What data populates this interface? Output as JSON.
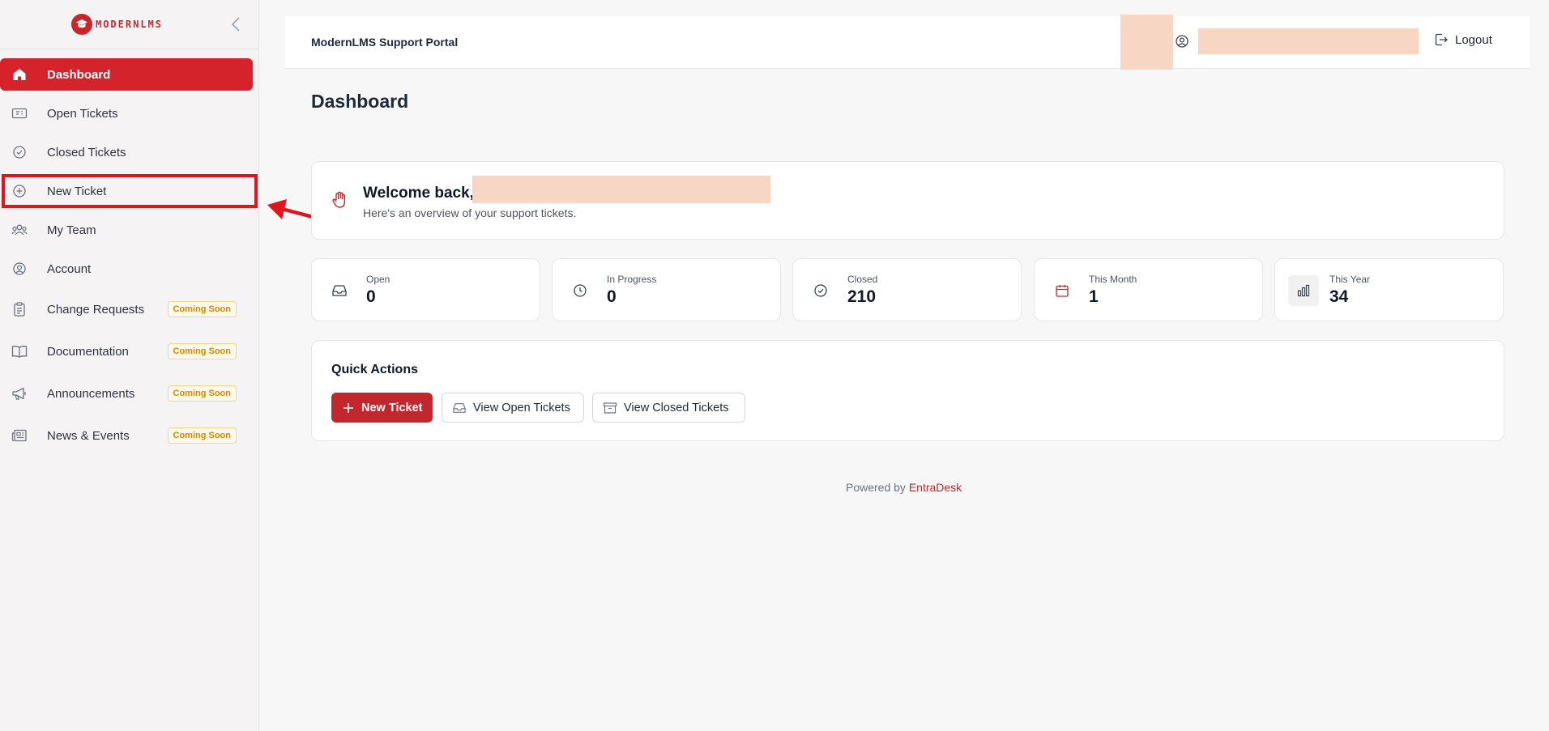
{
  "sidebar": {
    "logo_text": "MODERNLMS",
    "items": [
      {
        "label": "Dashboard",
        "icon": "home-icon"
      },
      {
        "label": "Open Tickets",
        "icon": "ticket-icon"
      },
      {
        "label": "Closed Tickets",
        "icon": "check-circle-icon"
      },
      {
        "label": "New Ticket",
        "icon": "plus-circle-icon"
      },
      {
        "label": "My Team",
        "icon": "users-icon"
      },
      {
        "label": "Account",
        "icon": "user-circle-icon"
      },
      {
        "label": "Change Requests",
        "icon": "clipboard-icon",
        "badge": "Coming Soon"
      },
      {
        "label": "Documentation",
        "icon": "book-icon",
        "badge": "Coming Soon"
      },
      {
        "label": "Announcements",
        "icon": "megaphone-icon",
        "badge": "Coming Soon"
      },
      {
        "label": "News & Events",
        "icon": "newspaper-icon",
        "badge": "Coming Soon"
      }
    ]
  },
  "header": {
    "title": "ModernLMS Support Portal",
    "logout_label": "Logout"
  },
  "main": {
    "page_title": "Dashboard",
    "welcome": {
      "title": "Welcome back,",
      "subtitle": "Here's an overview of your support tickets."
    },
    "stats": [
      {
        "label": "Open",
        "value": "0",
        "icon": "inbox-icon"
      },
      {
        "label": "In Progress",
        "value": "0",
        "icon": "clock-icon"
      },
      {
        "label": "Closed",
        "value": "210",
        "icon": "check-circle-icon"
      },
      {
        "label": "This Month",
        "value": "1",
        "icon": "calendar-icon"
      },
      {
        "label": "This Year",
        "value": "34",
        "icon": "bar-chart-icon"
      }
    ],
    "quick_actions": {
      "title": "Quick Actions",
      "new_ticket": "New Ticket",
      "view_open": "View Open Tickets",
      "view_closed": "View Closed Tickets"
    },
    "footer": {
      "prefix": "Powered by",
      "brand": "EntraDesk"
    }
  },
  "colors": {
    "accent": "#d4232a",
    "highlight_outline": "#e1141c",
    "redaction": "#f7d6c4",
    "badge_text": "#d08a00"
  }
}
